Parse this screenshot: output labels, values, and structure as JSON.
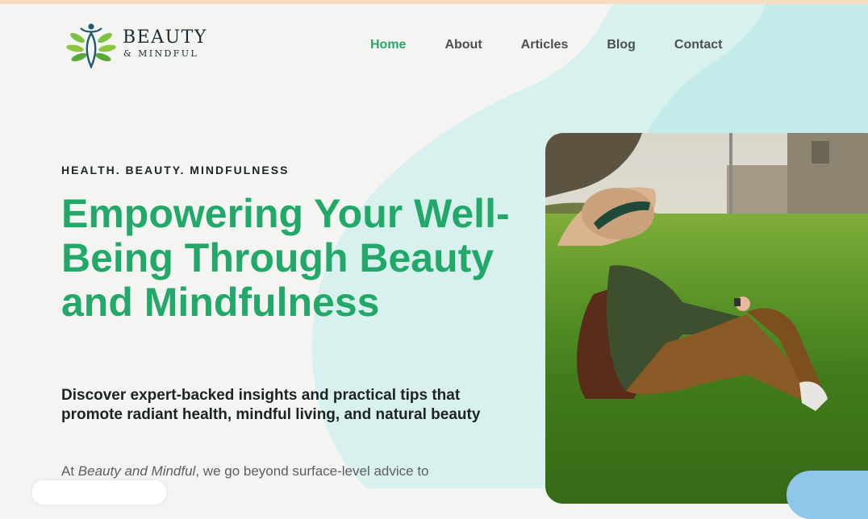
{
  "brand": {
    "name": "BEAUTY",
    "tagline": "& MINDFUL",
    "logo_icon": "leaf-figure-logo",
    "colors": {
      "green": "#22a868",
      "dark": "#1b2a33",
      "aqua": "#c6ecea"
    }
  },
  "nav": {
    "items": [
      {
        "label": "Home",
        "active": true
      },
      {
        "label": "About",
        "active": false
      },
      {
        "label": "Articles",
        "active": false
      },
      {
        "label": "Blog",
        "active": false
      },
      {
        "label": "Contact",
        "active": false
      }
    ]
  },
  "hero": {
    "eyebrow": "HEALTH. BEAUTY. MINDFULNESS",
    "title": "Empowering Your Well-Being Through Beauty and Mindfulness",
    "subtitle": "Discover expert-backed insights and practical tips that promote radiant health, mindful living, and natural beauty",
    "body_prefix": "At ",
    "body_emphasis": "Beauty and Mindful",
    "body_suffix": ", we go beyond surface-level advice to"
  }
}
